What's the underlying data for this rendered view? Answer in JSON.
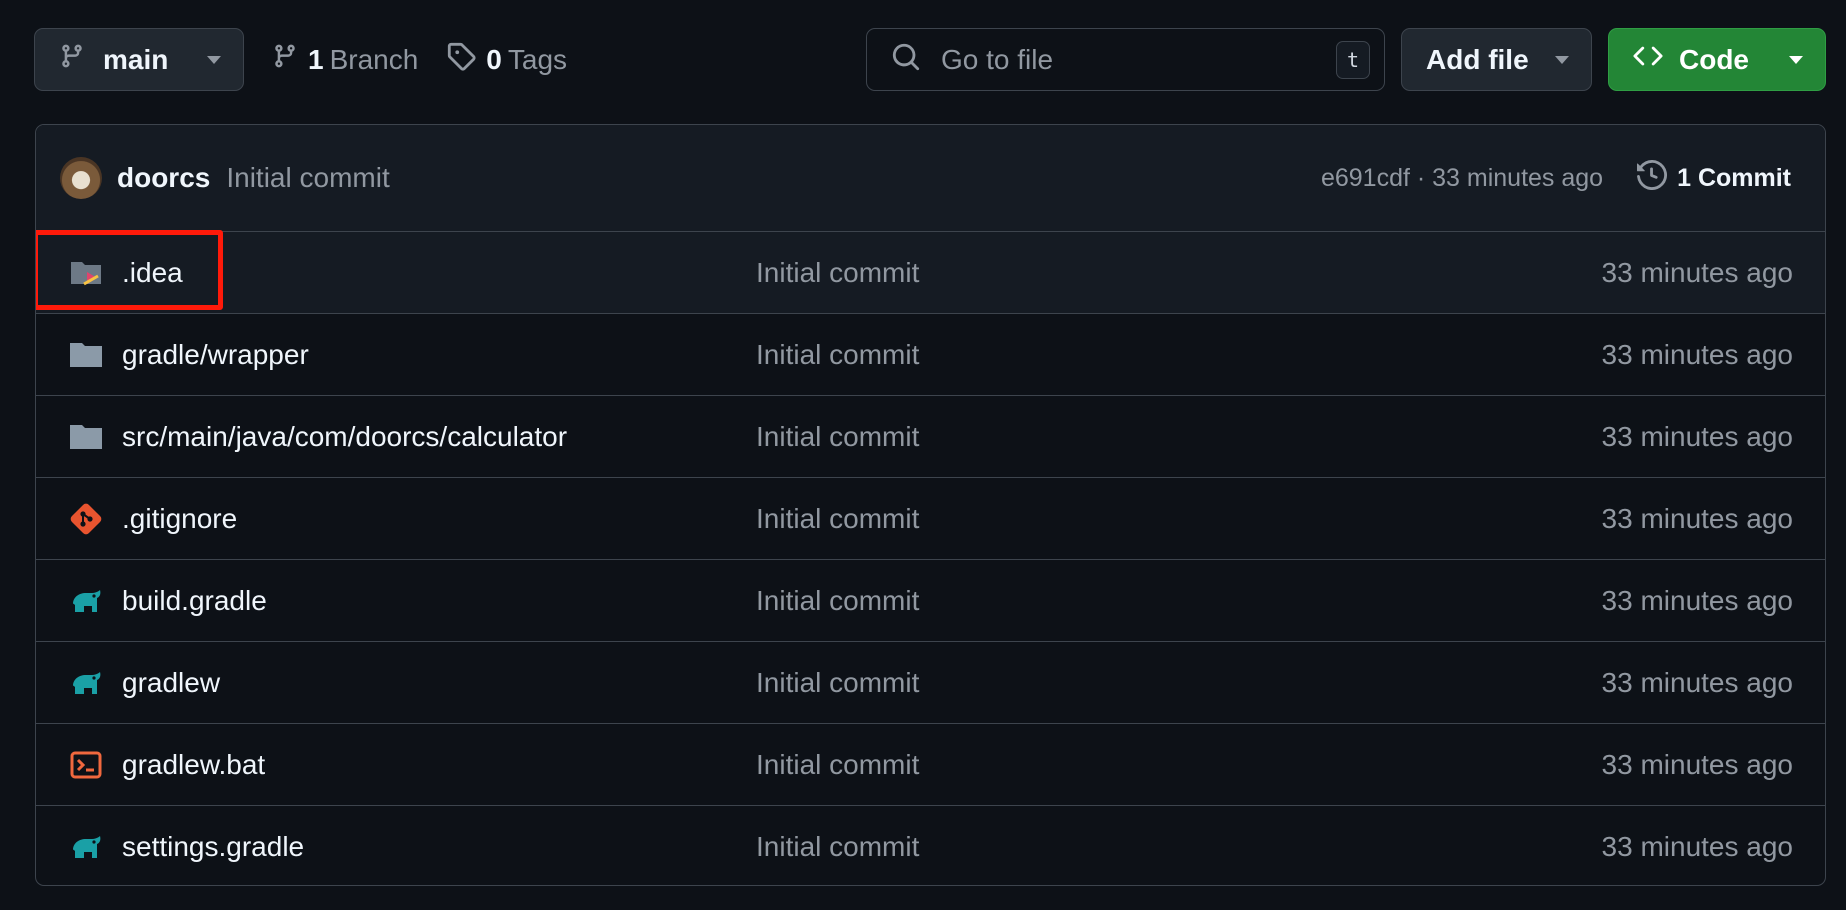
{
  "toolbar": {
    "branch_label": "main",
    "branch_count": "1",
    "branch_text": "Branch",
    "tag_count": "0",
    "tag_text": "Tags",
    "search_placeholder": "Go to file",
    "search_shortcut": "t",
    "add_file_label": "Add file",
    "code_label": "Code"
  },
  "commit": {
    "author": "doorcs",
    "message": "Initial commit",
    "sha_time": "e691cdf · 33 minutes ago",
    "commit_count_label": "1 Commit"
  },
  "files": [
    {
      "name": ".idea",
      "message": "Initial commit",
      "time": "33 minutes ago",
      "icon": "idea-folder-icon"
    },
    {
      "name": "gradle/wrapper",
      "message": "Initial commit",
      "time": "33 minutes ago",
      "icon": "folder-icon"
    },
    {
      "name": "src/main/java/com/doorcs/calculator",
      "message": "Initial commit",
      "time": "33 minutes ago",
      "icon": "folder-icon"
    },
    {
      "name": ".gitignore",
      "message": "Initial commit",
      "time": "33 minutes ago",
      "icon": "git-icon"
    },
    {
      "name": "build.gradle",
      "message": "Initial commit",
      "time": "33 minutes ago",
      "icon": "gradle-elephant-icon"
    },
    {
      "name": "gradlew",
      "message": "Initial commit",
      "time": "33 minutes ago",
      "icon": "gradle-elephant-icon"
    },
    {
      "name": "gradlew.bat",
      "message": "Initial commit",
      "time": "33 minutes ago",
      "icon": "terminal-icon"
    },
    {
      "name": "settings.gradle",
      "message": "Initial commit",
      "time": "33 minutes ago",
      "icon": "gradle-elephant-icon"
    }
  ],
  "colors": {
    "background": "#0d1117",
    "border": "#3d444d",
    "code_button": "#238636",
    "folder": "#8b9aa8",
    "git": "#e8542f",
    "gradle": "#1aa0a6",
    "terminal": "#f0683e",
    "highlight_box": "#ff1a0a"
  }
}
